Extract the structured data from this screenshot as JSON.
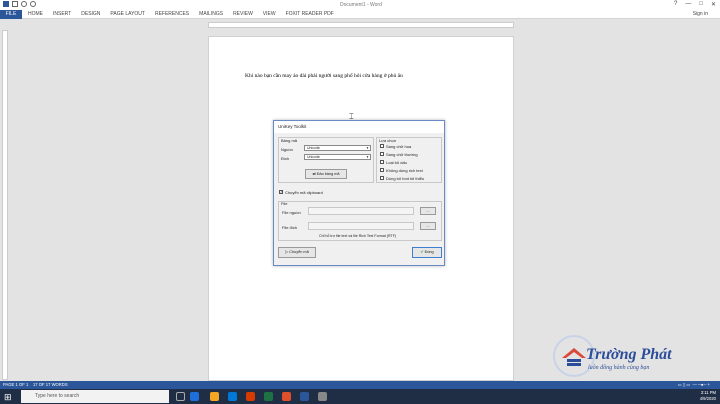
{
  "window": {
    "title": "Document1 - Word",
    "controls": [
      "?",
      "—",
      "□",
      "✕"
    ]
  },
  "ribbon": {
    "file_label": "FILE",
    "tabs": [
      "HOME",
      "INSERT",
      "DESIGN",
      "PAGE LAYOUT",
      "REFERENCES",
      "MAILINGS",
      "REVIEW",
      "VIEW",
      "FOXIT READER PDF"
    ],
    "sign_in": "Sign in"
  },
  "document": {
    "text": "Khi nào bạn cần may áo dài phải người sang phố hỏi cửa hàng ở phủ âu"
  },
  "dialog": {
    "title": "UniKey Toolkit",
    "encoding_group": "Bảng mã",
    "source_label": "Nguồn",
    "source_value": "Unicode",
    "dest_label": "Đích",
    "dest_value": "Unicode",
    "swap_button": "Đảo bảng mã",
    "options_group": "Lựa chọn",
    "options": [
      {
        "label": "Sang chữ hoa",
        "checked": false
      },
      {
        "label": "Sang chữ thường",
        "checked": false
      },
      {
        "label": "Loại bỏ dấu",
        "checked": false
      },
      {
        "label": "Không dùng rich text",
        "checked": false
      },
      {
        "label": "Dùng bỏ font tối thiểu",
        "checked": false
      }
    ],
    "clipboard_label": "Chuyển mã clipboard",
    "clipboard_checked": true,
    "file_group": "File",
    "file_source_label": "File nguồn",
    "file_dest_label": "File đích",
    "browse_label": "...",
    "note": "Chỉ hỗ trợ file text và file Rich Text Format (RTF)",
    "convert_button": "Chuyển mã",
    "close_button": "Đóng"
  },
  "statusbar": {
    "page": "PAGE 1 OF 1",
    "words": "17 OF 17 WORDS"
  },
  "taskbar": {
    "search_placeholder": "Type here to search",
    "time": "3:11 PM",
    "date": "4/9/2020",
    "colors": [
      "#1e6fd9",
      "#f5a623",
      "#0078d7",
      "#d83b01",
      "#1e7145",
      "#e04f2b",
      "#2b579a",
      "#888888"
    ]
  },
  "logo": {
    "text": "Trường Phát",
    "slogan": "luôn đồng hành cùng bạn"
  }
}
